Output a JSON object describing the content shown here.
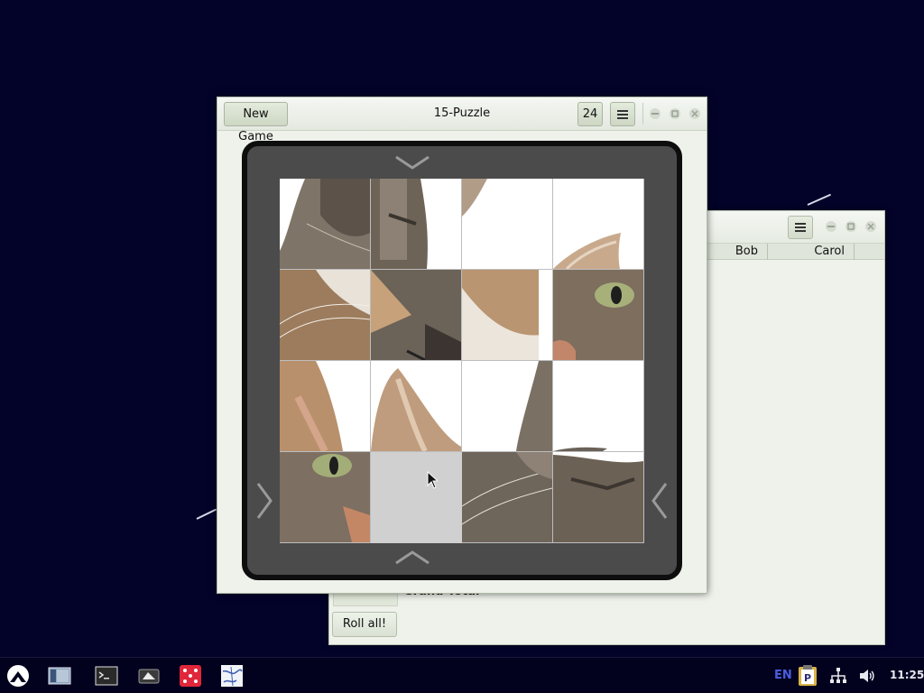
{
  "back_window": {
    "columns": [
      "Bob",
      "Carol"
    ],
    "grand_total_label": "Grand Total",
    "roll_all_label": "Roll all!"
  },
  "puzzle_window": {
    "new_game_label": "New Game",
    "title": "15-Puzzle",
    "move_count": "24",
    "board": {
      "rows": 4,
      "cols": 4,
      "empty_tile": {
        "row": 4,
        "col": 2
      }
    }
  },
  "taskbar": {
    "apps": [
      "launcher-icon",
      "file-manager-icon",
      "terminal-icon",
      "screenshot-icon",
      "dice-icon",
      "puzzle-icon"
    ],
    "keyboard_layout": "EN",
    "clock": "11:25"
  },
  "colors": {
    "desktop": "#03032a",
    "window_bg": "#eef2ea",
    "board_frame": "#4b4b4b",
    "dice_app": "#e0263a",
    "layout_indicator": "#3a4bc8"
  }
}
